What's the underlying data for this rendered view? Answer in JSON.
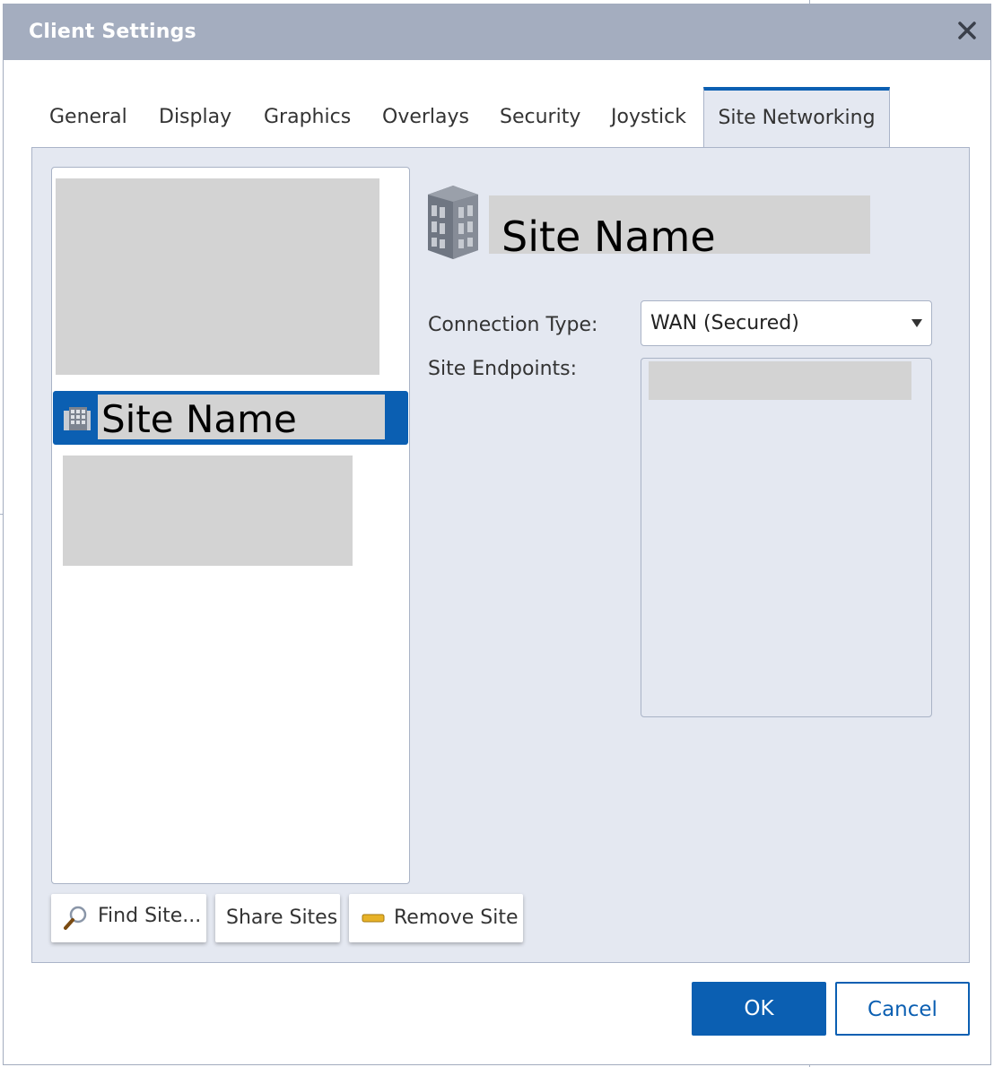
{
  "window": {
    "title": "Client Settings"
  },
  "tabs": [
    {
      "label": "General"
    },
    {
      "label": "Display"
    },
    {
      "label": "Graphics"
    },
    {
      "label": "Overlays"
    },
    {
      "label": "Security"
    },
    {
      "label": "Joystick"
    },
    {
      "label": "Site Networking",
      "active": true
    }
  ],
  "site_list": {
    "selected_item": {
      "label": "Site Name",
      "icon": "building-icon"
    }
  },
  "buttons": {
    "find_site": "Find Site...",
    "share_sites": "Share Sites",
    "remove_site": "Remove Site",
    "ok": "OK",
    "cancel": "Cancel"
  },
  "details": {
    "site_name": "Site Name",
    "connection_type_label": "Connection Type:",
    "connection_type_value": "WAN (Secured)",
    "site_endpoints_label": "Site Endpoints:"
  },
  "colors": {
    "accent": "#0b5fb2",
    "titlebar": "#a4adbf",
    "panel": "#e4e8f1",
    "redacted": "#d3d3d3"
  }
}
